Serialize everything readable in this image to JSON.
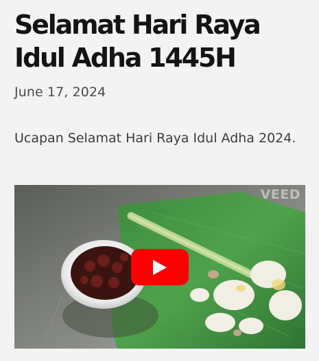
{
  "post": {
    "title": "Selamat Hari Raya Idul Adha 1445H",
    "date": "June 17, 2024",
    "excerpt": "Ucapan Selamat Hari Raya Idul Adha 2024."
  },
  "video": {
    "watermark": "VEED",
    "play_icon": "youtube-play-icon",
    "play_color": "#ff0000"
  }
}
